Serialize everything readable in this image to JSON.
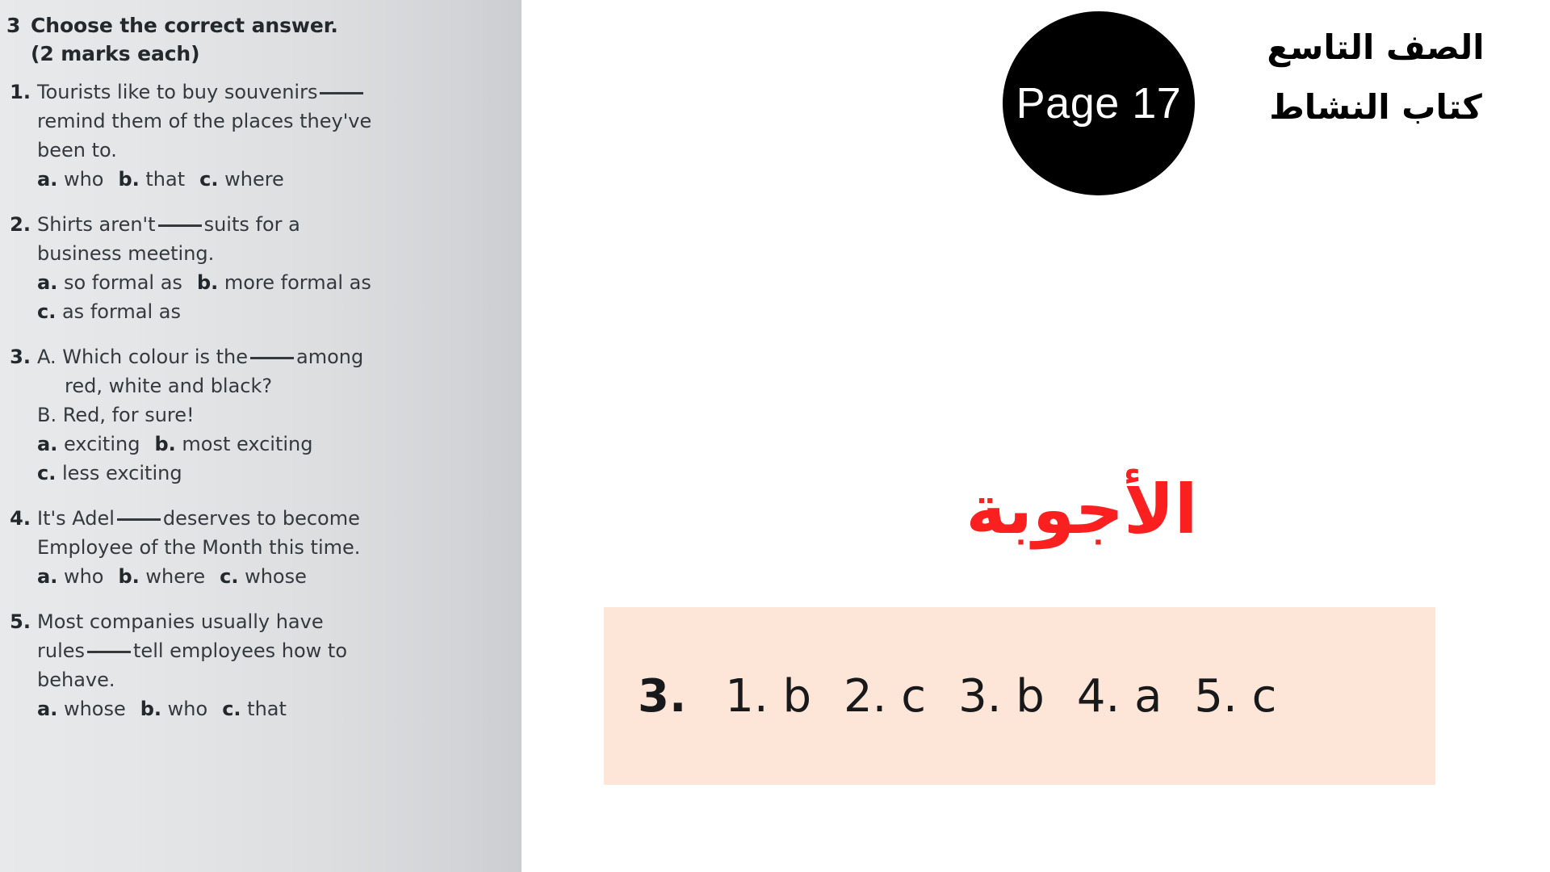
{
  "worksheet": {
    "exercise_number": "3",
    "title": "Choose the correct answer.",
    "subtitle": "(2 marks each)",
    "questions": [
      {
        "number": "1.",
        "lines": [
          {
            "text": "Tourists like to buy souvenirs",
            "blank_after": true,
            "indent": false
          },
          {
            "text": "remind them of the places they've",
            "blank_after": false,
            "indent": false
          },
          {
            "text": "been to.",
            "blank_after": false,
            "indent": false
          }
        ],
        "option_rows": [
          [
            {
              "key": "a.",
              "label": "who"
            },
            {
              "key": "b.",
              "label": "that"
            },
            {
              "key": "c.",
              "label": "where"
            }
          ]
        ]
      },
      {
        "number": "2.",
        "lines": [
          {
            "text": "Shirts aren't",
            "blank_after": true,
            "after_blank": "suits for a",
            "indent": false
          },
          {
            "text": "business meeting.",
            "blank_after": false,
            "indent": false
          }
        ],
        "option_rows": [
          [
            {
              "key": "a.",
              "label": "so formal as"
            },
            {
              "key": "b.",
              "label": "more formal as"
            }
          ],
          [
            {
              "key": "c.",
              "label": "as formal as"
            }
          ]
        ]
      },
      {
        "number": "3.",
        "lines": [
          {
            "text": "A. Which colour is the",
            "blank_after": true,
            "after_blank": "among",
            "indent": false
          },
          {
            "text": "red, white and black?",
            "blank_after": false,
            "indent": true
          },
          {
            "text": "B. Red, for sure!",
            "blank_after": false,
            "indent": false
          }
        ],
        "option_rows": [
          [
            {
              "key": "a.",
              "label": "exciting"
            },
            {
              "key": "b.",
              "label": "most exciting"
            }
          ],
          [
            {
              "key": "c.",
              "label": "less exciting"
            }
          ]
        ]
      },
      {
        "number": "4.",
        "lines": [
          {
            "text": "It's Adel",
            "blank_after": true,
            "after_blank": "deserves to become",
            "indent": false
          },
          {
            "text": "Employee of the Month this time.",
            "blank_after": false,
            "indent": false
          }
        ],
        "option_rows": [
          [
            {
              "key": "a.",
              "label": "who"
            },
            {
              "key": "b.",
              "label": "where"
            },
            {
              "key": "c.",
              "label": "whose"
            }
          ]
        ]
      },
      {
        "number": "5.",
        "lines": [
          {
            "text": "Most companies usually have",
            "blank_after": false,
            "indent": false
          },
          {
            "text": "rules",
            "blank_after": true,
            "after_blank": "tell employees how to",
            "indent": false
          },
          {
            "text": "behave.",
            "blank_after": false,
            "indent": false
          }
        ],
        "option_rows": [
          [
            {
              "key": "a.",
              "label": "whose"
            },
            {
              "key": "b.",
              "label": "who"
            },
            {
              "key": "c.",
              "label": "that"
            }
          ]
        ]
      }
    ]
  },
  "page_badge": {
    "label": "Page 17"
  },
  "book_title": {
    "line1": "الصف التاسع",
    "line2": "كتاب النشاط"
  },
  "answers": {
    "heading": "الأجوبة",
    "exercise_label": "3.",
    "items": [
      "1. b",
      "2. c",
      "3. b",
      "4. a",
      "5. c"
    ]
  },
  "colors": {
    "panel_background_light": "#e7e9ea",
    "panel_background_dark": "#cbcdd0",
    "badge_background": "#000000",
    "badge_text": "#ffffff",
    "answers_heading": "#fa2020",
    "answers_box_background": "#fde6d7",
    "body_text": "#34393d"
  }
}
